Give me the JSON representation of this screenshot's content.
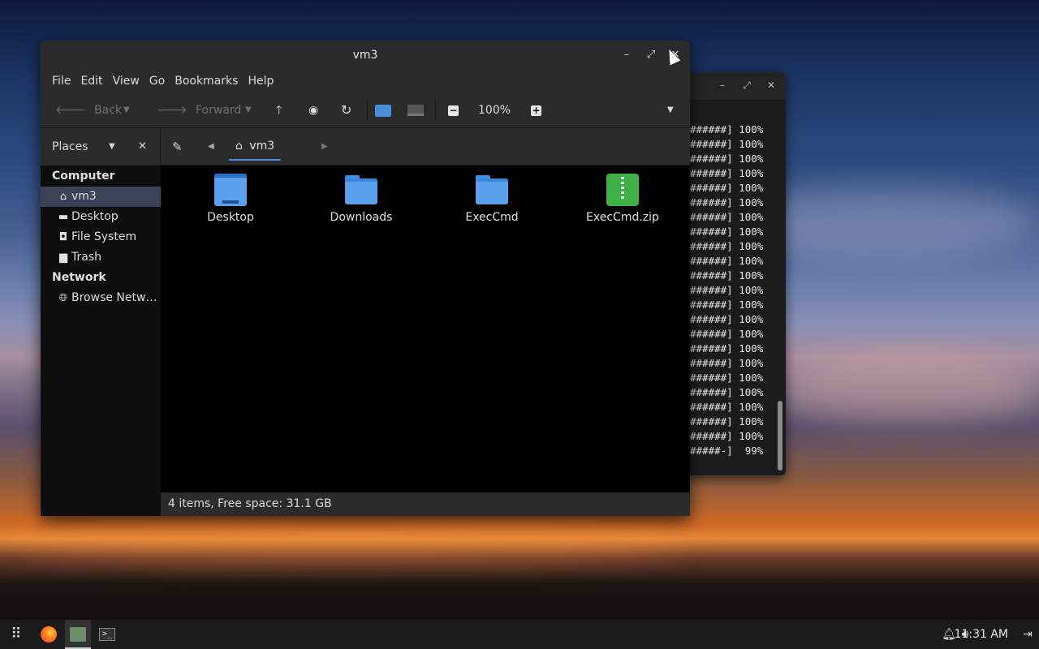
{
  "terminal": {
    "lines": [
      "######] 100%",
      "######] 100%",
      "######] 100%",
      "######] 100%",
      "######] 100%",
      "######] 100%",
      "######] 100%",
      "######] 100%",
      "######] 100%",
      "######] 100%",
      "######] 100%",
      "######] 100%",
      "######] 100%",
      "######] 100%",
      "######] 100%",
      "######] 100%",
      "######] 100%",
      "######] 100%",
      "######] 100%",
      "######] 100%",
      "######] 100%",
      "######] 100%",
      "#####-]  99%"
    ]
  },
  "file_manager": {
    "title": "vm3",
    "menu": [
      "File",
      "Edit",
      "View",
      "Go",
      "Bookmarks",
      "Help"
    ],
    "toolbar": {
      "back_label": "Back",
      "forward_label": "Forward",
      "zoom_level": "100%"
    },
    "sidebar": {
      "pane_label": "Places",
      "sections": [
        {
          "heading": "Computer",
          "items": [
            {
              "label": "vm3",
              "icon": "home-icon",
              "selected": true
            },
            {
              "label": "Desktop",
              "icon": "desktop-icon"
            },
            {
              "label": "File System",
              "icon": "drive-icon"
            },
            {
              "label": "Trash",
              "icon": "trash-icon"
            }
          ]
        },
        {
          "heading": "Network",
          "items": [
            {
              "label": "Browse Netw…",
              "icon": "globe-icon"
            }
          ]
        }
      ]
    },
    "location": {
      "crumb": "vm3"
    },
    "items": [
      {
        "label": "Desktop",
        "icon": "desktop-folder-icon"
      },
      {
        "label": "Downloads",
        "icon": "folder-icon"
      },
      {
        "label": "ExecCmd",
        "icon": "folder-icon"
      },
      {
        "label": "ExecCmd.zip",
        "icon": "zip-icon"
      }
    ],
    "status": "4 items, Free space: 31.1 GB"
  },
  "taskbar": {
    "clock": "11:31 AM"
  },
  "colors": {
    "accent": "#4a90d9",
    "folder": "#5aa1ef",
    "zip": "#3db048",
    "selection": "#3b4257"
  }
}
